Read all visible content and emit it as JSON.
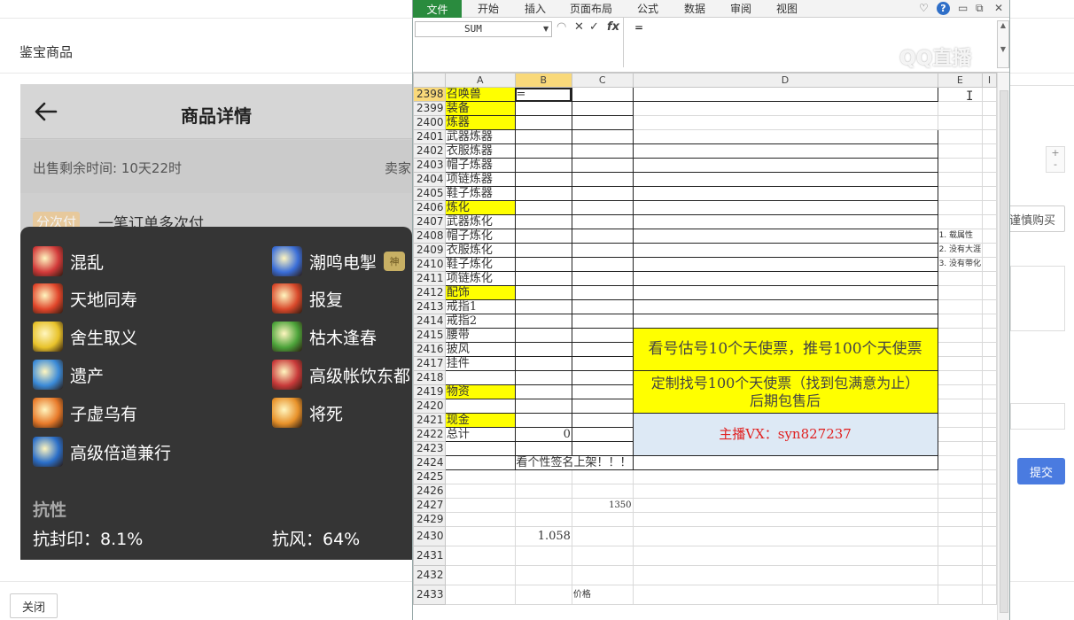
{
  "page": {
    "title": "鉴宝商品",
    "close_label": "关闭",
    "buy_label": "谨慎购买",
    "submit_label": "提交",
    "stepper_plus": "+",
    "stepper_minus": "-"
  },
  "phone": {
    "header_title": "商品详情",
    "sale_remaining": "出售剩余时间: 10天22时",
    "seller_label": "卖家",
    "pay_badge": "分次付",
    "pay_text": "一笔订单多次付",
    "skills": [
      {
        "name": "混乱",
        "color": "#d23a3a"
      },
      {
        "name": "潮鸣电掣",
        "color": "#3a6ed8",
        "badge": "神"
      },
      {
        "name": "天地同寿",
        "color": "#e0452a"
      },
      {
        "name": "报复",
        "color": "#d8482a"
      },
      {
        "name": "舍生取义",
        "color": "#e8c22a"
      },
      {
        "name": "枯木逢春",
        "color": "#4ca33a"
      },
      {
        "name": "遗产",
        "color": "#3a8ad8"
      },
      {
        "name": "高级帐饮东都",
        "color": "#c83a3a"
      },
      {
        "name": "子虚乌有",
        "color": "#e87a2a"
      },
      {
        "name": "将死",
        "color": "#e8922a"
      },
      {
        "name": "高级倍道兼行",
        "color": "#2a6ec8"
      }
    ],
    "resist_title": "抗性",
    "resists": [
      {
        "text": "抗封印：8.1%"
      },
      {
        "text": "抗风：64%"
      }
    ]
  },
  "excel": {
    "tabs": [
      "文件",
      "开始",
      "插入",
      "页面布局",
      "公式",
      "数据",
      "审阅",
      "视图"
    ],
    "name_box": "SUM",
    "formula": "=",
    "columns": [
      "A",
      "B",
      "C",
      "D",
      "E",
      "I"
    ],
    "notes": [
      "1. 载属性",
      "2. 没有大涯",
      "3. 没有带化"
    ],
    "rows": [
      {
        "n": "2398",
        "a": "召唤兽",
        "a_yellow": true,
        "b": "=",
        "b_active": true
      },
      {
        "n": "2399",
        "a": "装备",
        "a_yellow": true
      },
      {
        "n": "2400",
        "a": "炼器",
        "a_yellow": true
      },
      {
        "n": "2401",
        "a": "武器炼器"
      },
      {
        "n": "2402",
        "a": "衣服炼器"
      },
      {
        "n": "2403",
        "a": "帽子炼器"
      },
      {
        "n": "2404",
        "a": "项链炼器"
      },
      {
        "n": "2405",
        "a": "鞋子炼器"
      },
      {
        "n": "2406",
        "a": "炼化",
        "a_yellow": true
      },
      {
        "n": "2407",
        "a": "武器炼化"
      },
      {
        "n": "2408",
        "a": "帽子炼化"
      },
      {
        "n": "2409",
        "a": "衣服炼化"
      },
      {
        "n": "2410",
        "a": "鞋子炼化"
      },
      {
        "n": "2411",
        "a": "项链炼化"
      },
      {
        "n": "2412",
        "a": "配饰",
        "a_yellow": true
      },
      {
        "n": "2413",
        "a": "戒指1"
      },
      {
        "n": "2414",
        "a": "戒指2"
      },
      {
        "n": "2415",
        "a": "腰带"
      },
      {
        "n": "2416",
        "a": "披风"
      },
      {
        "n": "2417",
        "a": "挂件"
      },
      {
        "n": "2418",
        "a": ""
      },
      {
        "n": "2419",
        "a": "物资",
        "a_yellow": true
      },
      {
        "n": "2420",
        "a": ""
      },
      {
        "n": "2421",
        "a": "现金",
        "a_yellow": true
      },
      {
        "n": "2422",
        "a": "总计",
        "b": "0"
      },
      {
        "n": "2423",
        "a": ""
      },
      {
        "n": "2424",
        "a": "",
        "b": "看个性签名上架！！！"
      },
      {
        "n": "2425"
      },
      {
        "n": "2426"
      },
      {
        "n": "2427",
        "c": "1350"
      },
      {
        "n": "2429"
      },
      {
        "n": "2430",
        "b": "1.058"
      },
      {
        "n": "2431"
      },
      {
        "n": "2432"
      },
      {
        "n": "2433",
        "c": "价格"
      }
    ],
    "panel_texts": {
      "line1": "看号估号10个天使票，推号100个天使票",
      "line2a": "定制找号100个天使票（找到包满意为止）",
      "line2b": "后期包售后",
      "line3": "主播VX：syn827237"
    },
    "panel_colors": {
      "yellow": "#ffff00",
      "blue": "#dde9f5",
      "red": "#e02020"
    }
  },
  "watermark": "QQ直播"
}
